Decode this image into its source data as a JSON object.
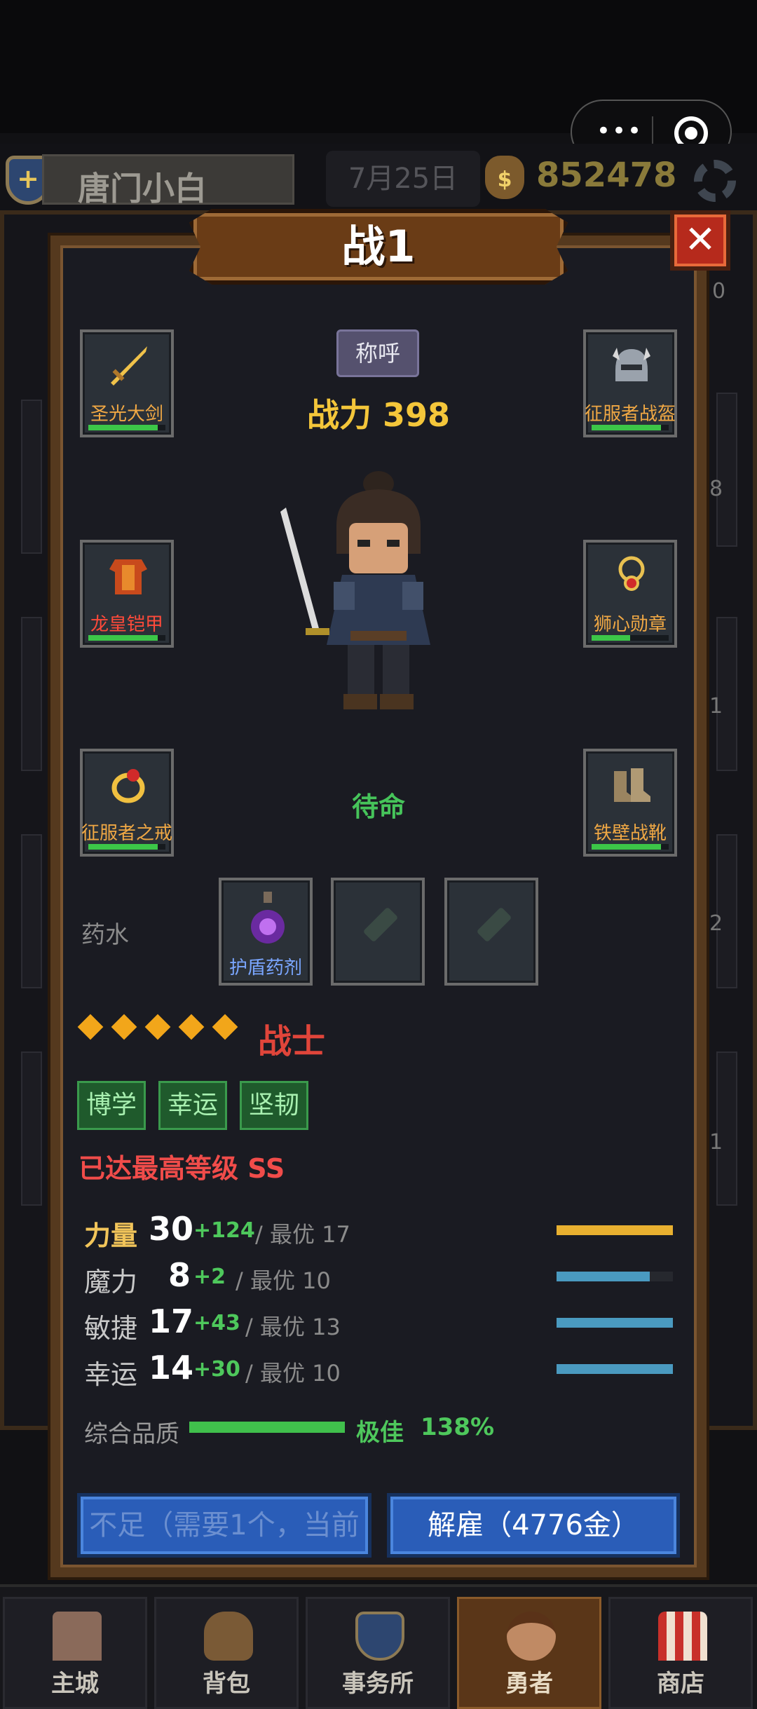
{
  "header": {
    "player_name": "唐门小白",
    "date": "7月25日",
    "gold": "852478",
    "coin_symbol": "$"
  },
  "capsule": {
    "dots": "•••"
  },
  "background_digits": [
    "0",
    "8",
    "1",
    "2",
    "1"
  ],
  "panel": {
    "title": "战1",
    "close_label": "✕",
    "title_badge": "称呼",
    "power_text": "战力 398",
    "status": "待命"
  },
  "equipment": [
    {
      "name": "圣光大剑",
      "icon": "sword-icon",
      "durability": 0.9,
      "label_color": "#f0a844"
    },
    {
      "name": "征服者战盔",
      "icon": "helmet-icon",
      "durability": 0.9,
      "label_color": "#f0a844"
    },
    {
      "name": "龙皇铠甲",
      "icon": "armor-icon",
      "durability": 0.9,
      "label_color": "#ff4a3a"
    },
    {
      "name": "狮心勋章",
      "icon": "amulet-icon",
      "durability": 0.5,
      "label_color": "#f0a844"
    },
    {
      "name": "征服者之戒",
      "icon": "ring-icon",
      "durability": 0.9,
      "label_color": "#f0a844"
    },
    {
      "name": "铁壁战靴",
      "icon": "boots-icon",
      "durability": 0.9,
      "label_color": "#f0a844"
    }
  ],
  "potions": {
    "label": "药水",
    "items": [
      {
        "name": "护盾药剂",
        "icon": "potion-icon"
      },
      {
        "name": "",
        "icon": "empty-vial-icon"
      },
      {
        "name": "",
        "icon": "empty-vial-icon"
      }
    ]
  },
  "hero": {
    "stars": 5,
    "class_name": "战士",
    "traits": [
      "博学",
      "幸运",
      "坚韧"
    ],
    "max_level_text": "已达最高等级 SS"
  },
  "stats": [
    {
      "name": "力量",
      "value": "30",
      "bonus": "+124",
      "best": "/  最优 17",
      "fill": 1.0,
      "color": "#e8b030",
      "highlight": true
    },
    {
      "name": "魔力",
      "value": "8",
      "bonus": "+2",
      "best": "/  最优 10",
      "fill": 0.8,
      "color": "#4a9ac0",
      "highlight": false
    },
    {
      "name": "敏捷",
      "value": "17",
      "bonus": "+43",
      "best": "/  最优 13",
      "fill": 1.0,
      "color": "#4a9ac0",
      "highlight": false
    },
    {
      "name": "幸运",
      "value": "14",
      "bonus": "+30",
      "best": "/  最优 10",
      "fill": 1.0,
      "color": "#4a9ac0",
      "highlight": false
    }
  ],
  "overall": {
    "label": "综合品质",
    "grade": "极佳",
    "percent": "138%"
  },
  "buttons": {
    "left": "不足（需要1个，当前",
    "right": "解雇（4776金）"
  },
  "nav": [
    {
      "label": "主城",
      "icon": "castle-icon",
      "active": false
    },
    {
      "label": "背包",
      "icon": "bag-icon",
      "active": false
    },
    {
      "label": "事务所",
      "icon": "shield-icon",
      "active": false
    },
    {
      "label": "勇者",
      "icon": "hero-icon",
      "active": true
    },
    {
      "label": "商店",
      "icon": "shop-icon",
      "active": false
    }
  ]
}
